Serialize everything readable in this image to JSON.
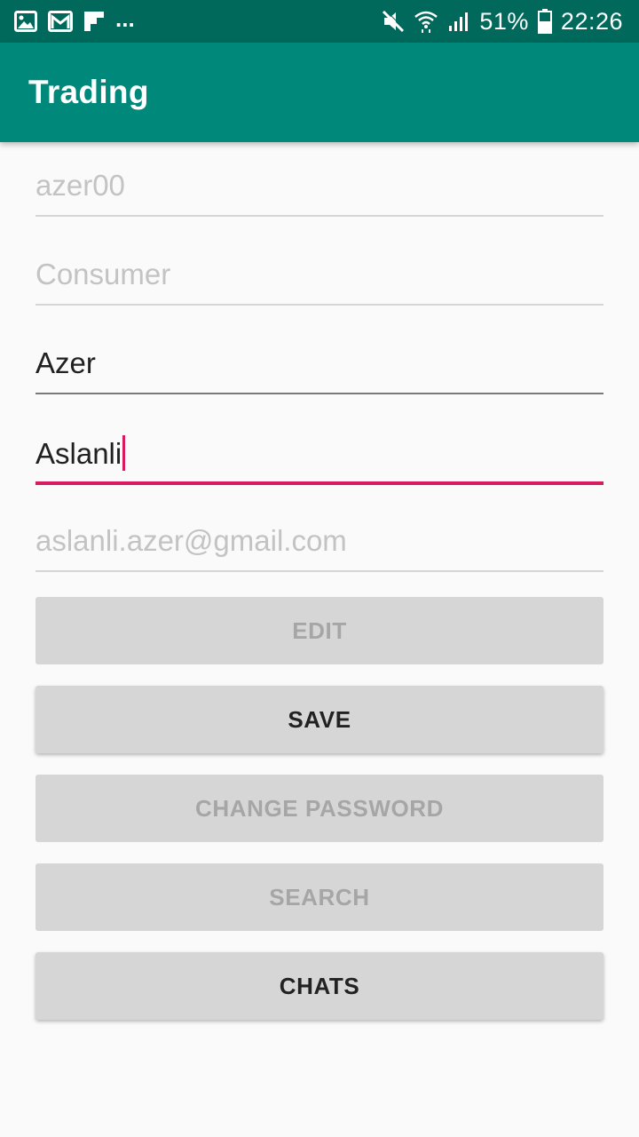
{
  "status_bar": {
    "left_icons": [
      "image-icon",
      "gmail-icon",
      "flipboard-icon"
    ],
    "overflow": "...",
    "right_icons": [
      "mute-icon",
      "wifi-icon",
      "signal-icon"
    ],
    "battery": "51%",
    "time": "22:26"
  },
  "app_bar": {
    "title": "Trading"
  },
  "form": {
    "username": "azer00",
    "role": "Consumer",
    "first_name": "Azer",
    "last_name": "Aslanli",
    "email": "aslanli.azer@gmail.com"
  },
  "buttons": {
    "edit": "EDIT",
    "save": "SAVE",
    "change_password": "CHANGE PASSWORD",
    "search": "SEARCH",
    "chats": "CHATS"
  },
  "colors": {
    "status_bar": "#00695c",
    "app_bar": "#00897b",
    "accent": "#d81b60",
    "button": "#d6d6d6"
  }
}
